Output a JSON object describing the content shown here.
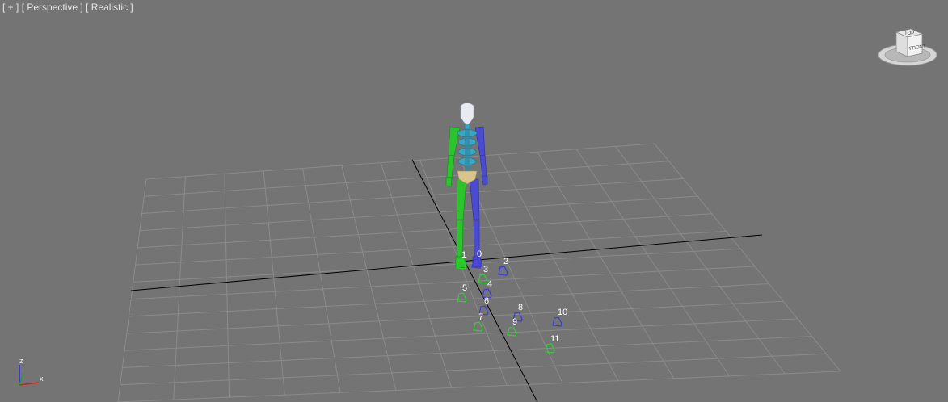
{
  "viewport": {
    "label": {
      "menu": "[ + ]",
      "view": "[ Perspective ]",
      "shading": "[ Realistic ]"
    },
    "viewcube": {
      "front": "FRONT",
      "top": "TOP"
    },
    "axis_tripod": {
      "x": "x",
      "z": "z"
    },
    "footsteps": [
      "0",
      "1",
      "2",
      "3",
      "4",
      "5",
      "6",
      "7",
      "8",
      "9",
      "10",
      "11"
    ]
  },
  "colors": {
    "background": "#747474",
    "grid": "#8a8a8a",
    "axis_lines": "#000000",
    "left_side": "#28c428",
    "right_side": "#4a4ad6",
    "spine": "#3aa6c4",
    "pelvis": "#d6c48a",
    "head": "#e8eaf0",
    "label_text": "#e6e6e6"
  }
}
